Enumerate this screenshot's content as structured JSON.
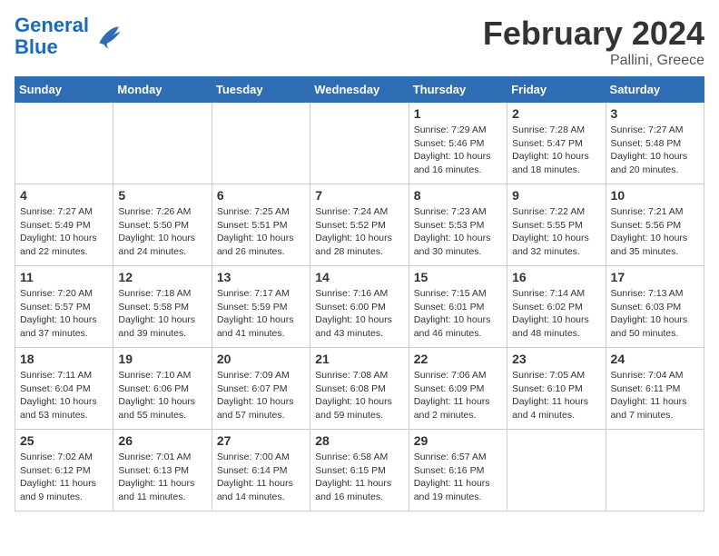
{
  "header": {
    "logo_line1": "General",
    "logo_line2": "Blue",
    "title": "February 2024",
    "subtitle": "Pallini, Greece"
  },
  "weekdays": [
    "Sunday",
    "Monday",
    "Tuesday",
    "Wednesday",
    "Thursday",
    "Friday",
    "Saturday"
  ],
  "weeks": [
    [
      {
        "day": "",
        "info": ""
      },
      {
        "day": "",
        "info": ""
      },
      {
        "day": "",
        "info": ""
      },
      {
        "day": "",
        "info": ""
      },
      {
        "day": "1",
        "info": "Sunrise: 7:29 AM\nSunset: 5:46 PM\nDaylight: 10 hours\nand 16 minutes."
      },
      {
        "day": "2",
        "info": "Sunrise: 7:28 AM\nSunset: 5:47 PM\nDaylight: 10 hours\nand 18 minutes."
      },
      {
        "day": "3",
        "info": "Sunrise: 7:27 AM\nSunset: 5:48 PM\nDaylight: 10 hours\nand 20 minutes."
      }
    ],
    [
      {
        "day": "4",
        "info": "Sunrise: 7:27 AM\nSunset: 5:49 PM\nDaylight: 10 hours\nand 22 minutes."
      },
      {
        "day": "5",
        "info": "Sunrise: 7:26 AM\nSunset: 5:50 PM\nDaylight: 10 hours\nand 24 minutes."
      },
      {
        "day": "6",
        "info": "Sunrise: 7:25 AM\nSunset: 5:51 PM\nDaylight: 10 hours\nand 26 minutes."
      },
      {
        "day": "7",
        "info": "Sunrise: 7:24 AM\nSunset: 5:52 PM\nDaylight: 10 hours\nand 28 minutes."
      },
      {
        "day": "8",
        "info": "Sunrise: 7:23 AM\nSunset: 5:53 PM\nDaylight: 10 hours\nand 30 minutes."
      },
      {
        "day": "9",
        "info": "Sunrise: 7:22 AM\nSunset: 5:55 PM\nDaylight: 10 hours\nand 32 minutes."
      },
      {
        "day": "10",
        "info": "Sunrise: 7:21 AM\nSunset: 5:56 PM\nDaylight: 10 hours\nand 35 minutes."
      }
    ],
    [
      {
        "day": "11",
        "info": "Sunrise: 7:20 AM\nSunset: 5:57 PM\nDaylight: 10 hours\nand 37 minutes."
      },
      {
        "day": "12",
        "info": "Sunrise: 7:18 AM\nSunset: 5:58 PM\nDaylight: 10 hours\nand 39 minutes."
      },
      {
        "day": "13",
        "info": "Sunrise: 7:17 AM\nSunset: 5:59 PM\nDaylight: 10 hours\nand 41 minutes."
      },
      {
        "day": "14",
        "info": "Sunrise: 7:16 AM\nSunset: 6:00 PM\nDaylight: 10 hours\nand 43 minutes."
      },
      {
        "day": "15",
        "info": "Sunrise: 7:15 AM\nSunset: 6:01 PM\nDaylight: 10 hours\nand 46 minutes."
      },
      {
        "day": "16",
        "info": "Sunrise: 7:14 AM\nSunset: 6:02 PM\nDaylight: 10 hours\nand 48 minutes."
      },
      {
        "day": "17",
        "info": "Sunrise: 7:13 AM\nSunset: 6:03 PM\nDaylight: 10 hours\nand 50 minutes."
      }
    ],
    [
      {
        "day": "18",
        "info": "Sunrise: 7:11 AM\nSunset: 6:04 PM\nDaylight: 10 hours\nand 53 minutes."
      },
      {
        "day": "19",
        "info": "Sunrise: 7:10 AM\nSunset: 6:06 PM\nDaylight: 10 hours\nand 55 minutes."
      },
      {
        "day": "20",
        "info": "Sunrise: 7:09 AM\nSunset: 6:07 PM\nDaylight: 10 hours\nand 57 minutes."
      },
      {
        "day": "21",
        "info": "Sunrise: 7:08 AM\nSunset: 6:08 PM\nDaylight: 10 hours\nand 59 minutes."
      },
      {
        "day": "22",
        "info": "Sunrise: 7:06 AM\nSunset: 6:09 PM\nDaylight: 11 hours\nand 2 minutes."
      },
      {
        "day": "23",
        "info": "Sunrise: 7:05 AM\nSunset: 6:10 PM\nDaylight: 11 hours\nand 4 minutes."
      },
      {
        "day": "24",
        "info": "Sunrise: 7:04 AM\nSunset: 6:11 PM\nDaylight: 11 hours\nand 7 minutes."
      }
    ],
    [
      {
        "day": "25",
        "info": "Sunrise: 7:02 AM\nSunset: 6:12 PM\nDaylight: 11 hours\nand 9 minutes."
      },
      {
        "day": "26",
        "info": "Sunrise: 7:01 AM\nSunset: 6:13 PM\nDaylight: 11 hours\nand 11 minutes."
      },
      {
        "day": "27",
        "info": "Sunrise: 7:00 AM\nSunset: 6:14 PM\nDaylight: 11 hours\nand 14 minutes."
      },
      {
        "day": "28",
        "info": "Sunrise: 6:58 AM\nSunset: 6:15 PM\nDaylight: 11 hours\nand 16 minutes."
      },
      {
        "day": "29",
        "info": "Sunrise: 6:57 AM\nSunset: 6:16 PM\nDaylight: 11 hours\nand 19 minutes."
      },
      {
        "day": "",
        "info": ""
      },
      {
        "day": "",
        "info": ""
      }
    ]
  ]
}
